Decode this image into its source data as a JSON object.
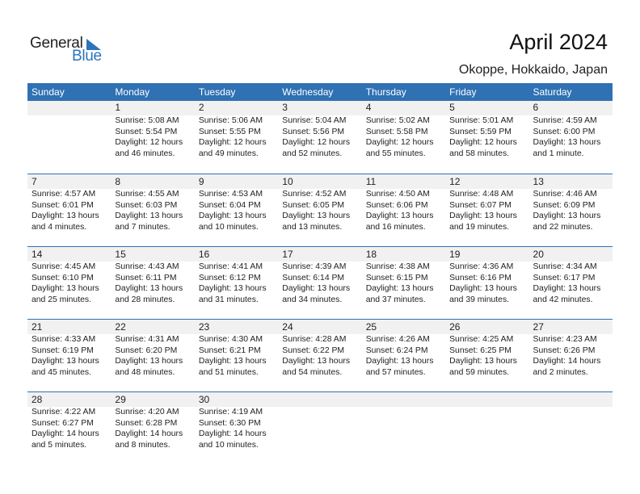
{
  "logo": {
    "word1": "General",
    "word2": "Blue",
    "accent_color": "#2a75bb"
  },
  "header": {
    "title": "April 2024",
    "location": "Okoppe, Hokkaido, Japan"
  },
  "colors": {
    "header_bar": "#2f71b3",
    "date_band": "#f1f1f1"
  },
  "calendar": {
    "day_names": [
      "Sunday",
      "Monday",
      "Tuesday",
      "Wednesday",
      "Thursday",
      "Friday",
      "Saturday"
    ],
    "weeks": [
      [
        null,
        {
          "day": "1",
          "sunrise": "Sunrise: 5:08 AM",
          "sunset": "Sunset: 5:54 PM",
          "daylight1": "Daylight: 12 hours",
          "daylight2": "and 46 minutes."
        },
        {
          "day": "2",
          "sunrise": "Sunrise: 5:06 AM",
          "sunset": "Sunset: 5:55 PM",
          "daylight1": "Daylight: 12 hours",
          "daylight2": "and 49 minutes."
        },
        {
          "day": "3",
          "sunrise": "Sunrise: 5:04 AM",
          "sunset": "Sunset: 5:56 PM",
          "daylight1": "Daylight: 12 hours",
          "daylight2": "and 52 minutes."
        },
        {
          "day": "4",
          "sunrise": "Sunrise: 5:02 AM",
          "sunset": "Sunset: 5:58 PM",
          "daylight1": "Daylight: 12 hours",
          "daylight2": "and 55 minutes."
        },
        {
          "day": "5",
          "sunrise": "Sunrise: 5:01 AM",
          "sunset": "Sunset: 5:59 PM",
          "daylight1": "Daylight: 12 hours",
          "daylight2": "and 58 minutes."
        },
        {
          "day": "6",
          "sunrise": "Sunrise: 4:59 AM",
          "sunset": "Sunset: 6:00 PM",
          "daylight1": "Daylight: 13 hours",
          "daylight2": "and 1 minute."
        }
      ],
      [
        {
          "day": "7",
          "sunrise": "Sunrise: 4:57 AM",
          "sunset": "Sunset: 6:01 PM",
          "daylight1": "Daylight: 13 hours",
          "daylight2": "and 4 minutes."
        },
        {
          "day": "8",
          "sunrise": "Sunrise: 4:55 AM",
          "sunset": "Sunset: 6:03 PM",
          "daylight1": "Daylight: 13 hours",
          "daylight2": "and 7 minutes."
        },
        {
          "day": "9",
          "sunrise": "Sunrise: 4:53 AM",
          "sunset": "Sunset: 6:04 PM",
          "daylight1": "Daylight: 13 hours",
          "daylight2": "and 10 minutes."
        },
        {
          "day": "10",
          "sunrise": "Sunrise: 4:52 AM",
          "sunset": "Sunset: 6:05 PM",
          "daylight1": "Daylight: 13 hours",
          "daylight2": "and 13 minutes."
        },
        {
          "day": "11",
          "sunrise": "Sunrise: 4:50 AM",
          "sunset": "Sunset: 6:06 PM",
          "daylight1": "Daylight: 13 hours",
          "daylight2": "and 16 minutes."
        },
        {
          "day": "12",
          "sunrise": "Sunrise: 4:48 AM",
          "sunset": "Sunset: 6:07 PM",
          "daylight1": "Daylight: 13 hours",
          "daylight2": "and 19 minutes."
        },
        {
          "day": "13",
          "sunrise": "Sunrise: 4:46 AM",
          "sunset": "Sunset: 6:09 PM",
          "daylight1": "Daylight: 13 hours",
          "daylight2": "and 22 minutes."
        }
      ],
      [
        {
          "day": "14",
          "sunrise": "Sunrise: 4:45 AM",
          "sunset": "Sunset: 6:10 PM",
          "daylight1": "Daylight: 13 hours",
          "daylight2": "and 25 minutes."
        },
        {
          "day": "15",
          "sunrise": "Sunrise: 4:43 AM",
          "sunset": "Sunset: 6:11 PM",
          "daylight1": "Daylight: 13 hours",
          "daylight2": "and 28 minutes."
        },
        {
          "day": "16",
          "sunrise": "Sunrise: 4:41 AM",
          "sunset": "Sunset: 6:12 PM",
          "daylight1": "Daylight: 13 hours",
          "daylight2": "and 31 minutes."
        },
        {
          "day": "17",
          "sunrise": "Sunrise: 4:39 AM",
          "sunset": "Sunset: 6:14 PM",
          "daylight1": "Daylight: 13 hours",
          "daylight2": "and 34 minutes."
        },
        {
          "day": "18",
          "sunrise": "Sunrise: 4:38 AM",
          "sunset": "Sunset: 6:15 PM",
          "daylight1": "Daylight: 13 hours",
          "daylight2": "and 37 minutes."
        },
        {
          "day": "19",
          "sunrise": "Sunrise: 4:36 AM",
          "sunset": "Sunset: 6:16 PM",
          "daylight1": "Daylight: 13 hours",
          "daylight2": "and 39 minutes."
        },
        {
          "day": "20",
          "sunrise": "Sunrise: 4:34 AM",
          "sunset": "Sunset: 6:17 PM",
          "daylight1": "Daylight: 13 hours",
          "daylight2": "and 42 minutes."
        }
      ],
      [
        {
          "day": "21",
          "sunrise": "Sunrise: 4:33 AM",
          "sunset": "Sunset: 6:19 PM",
          "daylight1": "Daylight: 13 hours",
          "daylight2": "and 45 minutes."
        },
        {
          "day": "22",
          "sunrise": "Sunrise: 4:31 AM",
          "sunset": "Sunset: 6:20 PM",
          "daylight1": "Daylight: 13 hours",
          "daylight2": "and 48 minutes."
        },
        {
          "day": "23",
          "sunrise": "Sunrise: 4:30 AM",
          "sunset": "Sunset: 6:21 PM",
          "daylight1": "Daylight: 13 hours",
          "daylight2": "and 51 minutes."
        },
        {
          "day": "24",
          "sunrise": "Sunrise: 4:28 AM",
          "sunset": "Sunset: 6:22 PM",
          "daylight1": "Daylight: 13 hours",
          "daylight2": "and 54 minutes."
        },
        {
          "day": "25",
          "sunrise": "Sunrise: 4:26 AM",
          "sunset": "Sunset: 6:24 PM",
          "daylight1": "Daylight: 13 hours",
          "daylight2": "and 57 minutes."
        },
        {
          "day": "26",
          "sunrise": "Sunrise: 4:25 AM",
          "sunset": "Sunset: 6:25 PM",
          "daylight1": "Daylight: 13 hours",
          "daylight2": "and 59 minutes."
        },
        {
          "day": "27",
          "sunrise": "Sunrise: 4:23 AM",
          "sunset": "Sunset: 6:26 PM",
          "daylight1": "Daylight: 14 hours",
          "daylight2": "and 2 minutes."
        }
      ],
      [
        {
          "day": "28",
          "sunrise": "Sunrise: 4:22 AM",
          "sunset": "Sunset: 6:27 PM",
          "daylight1": "Daylight: 14 hours",
          "daylight2": "and 5 minutes."
        },
        {
          "day": "29",
          "sunrise": "Sunrise: 4:20 AM",
          "sunset": "Sunset: 6:28 PM",
          "daylight1": "Daylight: 14 hours",
          "daylight2": "and 8 minutes."
        },
        {
          "day": "30",
          "sunrise": "Sunrise: 4:19 AM",
          "sunset": "Sunset: 6:30 PM",
          "daylight1": "Daylight: 14 hours",
          "daylight2": "and 10 minutes."
        },
        null,
        null,
        null,
        null
      ]
    ]
  }
}
